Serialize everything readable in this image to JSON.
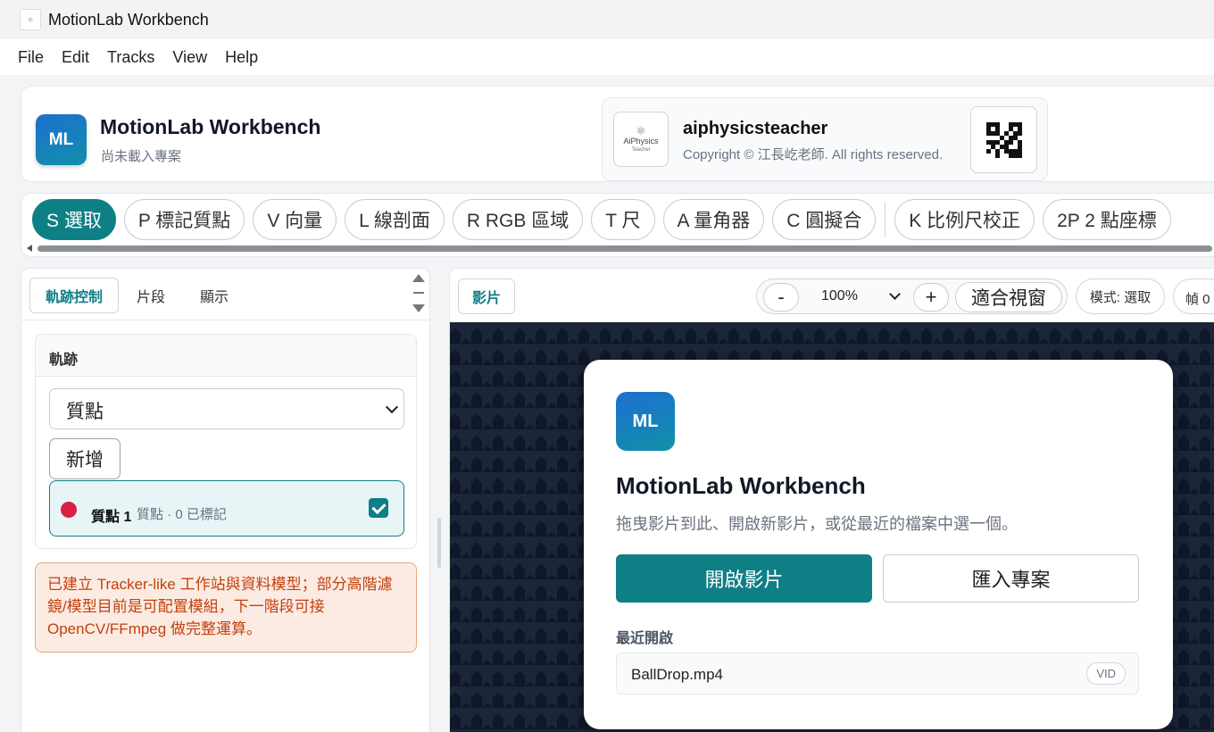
{
  "window": {
    "title": "MotionLab Workbench"
  },
  "menu": [
    "File",
    "Edit",
    "Tracks",
    "View",
    "Help"
  ],
  "header": {
    "logo": "ML",
    "title": "MotionLab Workbench",
    "subtitle": "尚未載入專案",
    "brand": {
      "logo_text": "AiPhysics",
      "logo_sub": "Teacher",
      "name": "aiphysicsteacher",
      "copyright": "Copyright © 江長屹老師. All rights reserved."
    }
  },
  "tools": [
    "S 選取",
    "P 標記質點",
    "V 向量",
    "L 線剖面",
    "R RGB 區域",
    "T 尺",
    "A 量角器",
    "C 圓擬合",
    "K 比例尺校正",
    "2P 2 點座標"
  ],
  "left_panel": {
    "tabs": [
      "軌跡控制",
      "片段",
      "顯示"
    ],
    "card_title": "軌跡",
    "select_value": "質點",
    "add_label": "新增",
    "track": {
      "name": "質點 1",
      "meta": "質點 · 0 已標記",
      "color": "#dc1f44",
      "checked": true
    },
    "notice": "已建立 Tracker-like 工作站與資料模型；部分高階濾鏡/模型目前是可配置模組，下一階段可接 OpenCV/FFmpeg 做完整運算。"
  },
  "right_panel": {
    "tab": "影片",
    "zoom_minus": "-",
    "zoom_value": "100%",
    "zoom_plus": "+",
    "fit_label": "適合視窗",
    "mode": "模式: 選取",
    "frame": "幀 0",
    "welcome": {
      "logo": "ML",
      "title": "MotionLab Workbench",
      "desc": "拖曳影片到此、開啟新影片，或從最近的檔案中選一個。",
      "open_label": "開啟影片",
      "import_label": "匯入專案",
      "recent_label": "最近開啟",
      "recent_file": "BallDrop.mp4",
      "recent_tag": "VID"
    }
  },
  "colors": {
    "accent": "#0f7f86",
    "stage_bg": "#0f172a",
    "notice_text": "#c2410c"
  }
}
